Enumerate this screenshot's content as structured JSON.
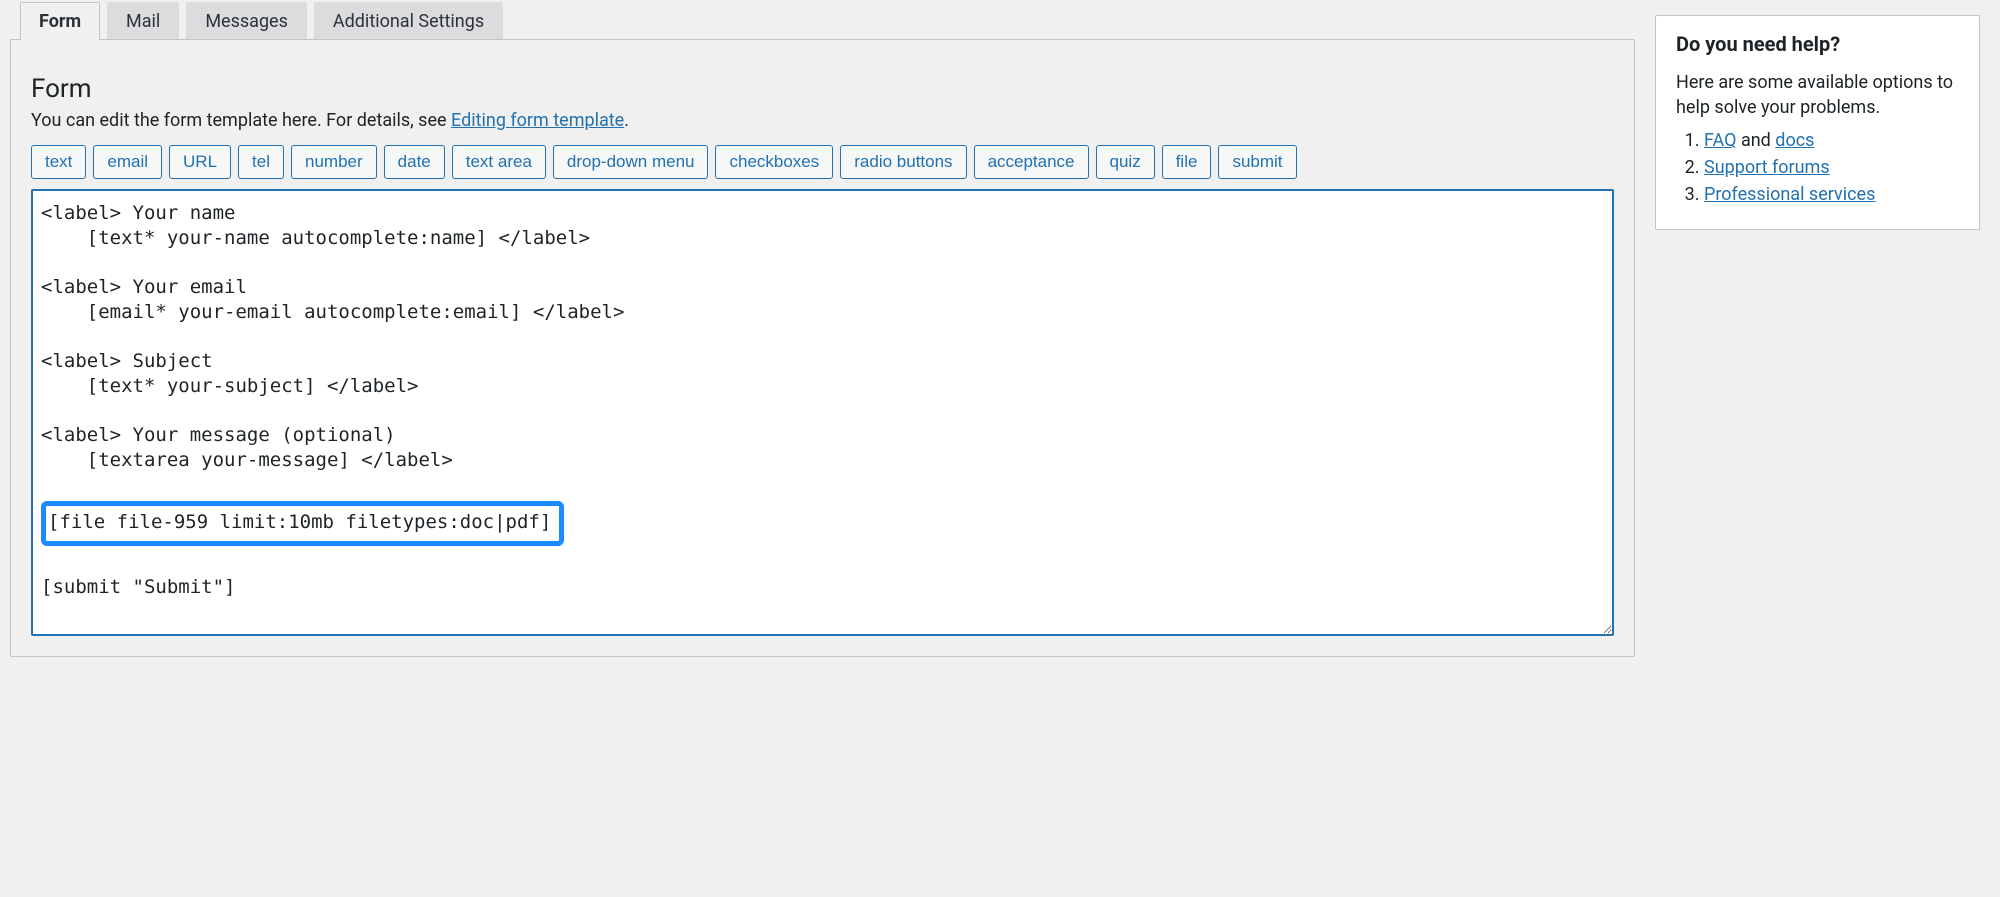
{
  "tabs": [
    {
      "label": "Form",
      "active": true
    },
    {
      "label": "Mail",
      "active": false
    },
    {
      "label": "Messages",
      "active": false
    },
    {
      "label": "Additional Settings",
      "active": false
    }
  ],
  "panel": {
    "heading": "Form",
    "description_prefix": "You can edit the form template here. For details, see ",
    "description_link": "Editing form template",
    "description_suffix": "."
  },
  "tag_buttons": [
    "text",
    "email",
    "URL",
    "tel",
    "number",
    "date",
    "text area",
    "drop-down menu",
    "checkboxes",
    "radio buttons",
    "acceptance",
    "quiz",
    "file",
    "submit"
  ],
  "form_code": {
    "lines": [
      "<label> Your name",
      "    [text* your-name autocomplete:name] </label>",
      "",
      "<label> Your email",
      "    [email* your-email autocomplete:email] </label>",
      "",
      "<label> Subject",
      "    [text* your-subject] </label>",
      "",
      "<label> Your message (optional)",
      "    [textarea your-message] </label>",
      ""
    ],
    "highlighted_line": "[file file-959 limit:10mb filetypes:doc|pdf]",
    "lines_after": [
      "",
      "[submit \"Submit\"]",
      ""
    ]
  },
  "sidebar": {
    "title": "Do you need help?",
    "intro": "Here are some available options to help solve your problems.",
    "items": [
      {
        "link": "FAQ",
        "suffix": " and ",
        "link2": "docs"
      },
      {
        "link": "Support forums"
      },
      {
        "link": "Professional services"
      }
    ]
  }
}
